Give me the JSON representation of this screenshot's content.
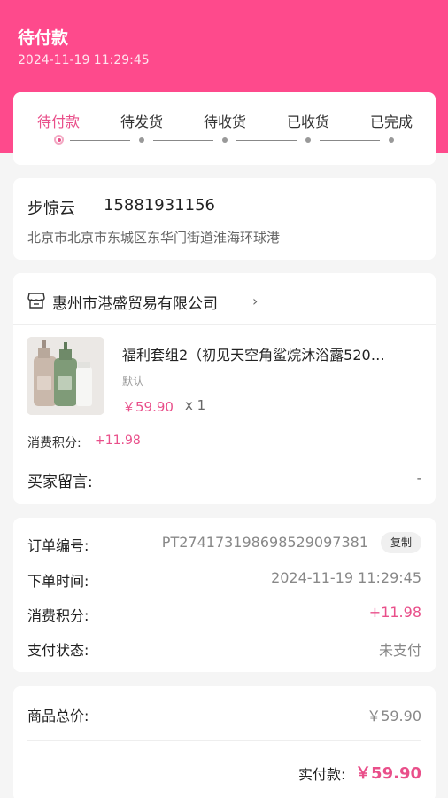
{
  "header": {
    "status_title": "待付款",
    "order_time": "2024-11-19 11:29:45"
  },
  "steps": {
    "items": [
      "待付款",
      "待发货",
      "待收货",
      "已收货",
      "已完成"
    ],
    "active_index": 0
  },
  "address": {
    "name": "步惊云",
    "phone": "15881931156",
    "detail": "北京市北京市东城区东华门街道淮海环球港"
  },
  "shop": {
    "icon": "store-icon",
    "name": "惠州市港盛贸易有限公司",
    "chevron": "›",
    "product": {
      "name": "福利套组2（初见天空角鲨烷沐浴露520…",
      "spec": "默认",
      "price": "￥59.90",
      "qty": "x 1"
    },
    "points_label": "消费积分:",
    "points_value": "+11.98",
    "message_label": "买家留言:",
    "message_value": "-"
  },
  "order_info": {
    "order_no_label": "订单编号:",
    "order_no": "PT274173198698529097381",
    "copy_label": "复制",
    "time_label": "下单时间:",
    "time_value": "2024-11-19 11:29:45",
    "points_label": "消费积分:",
    "points_value": "+11.98",
    "pay_status_label": "支付状态:",
    "pay_status_value": "未支付"
  },
  "totals": {
    "goods_total_label": "商品总价:",
    "goods_total_value": "￥59.90",
    "paid_label": "实付款:",
    "paid_value": "￥59.90"
  },
  "colors": {
    "brand": "#fe4a8c",
    "accent_text": "#e94f8a",
    "background": "#f5f5f5"
  }
}
